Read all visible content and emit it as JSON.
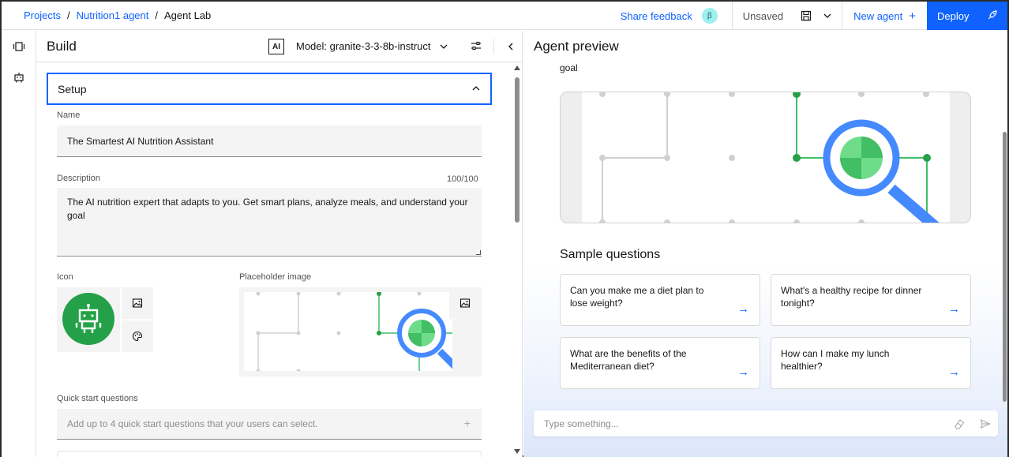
{
  "header": {
    "breadcrumb": [
      "Projects",
      "Nutrition1 agent",
      "Agent Lab"
    ],
    "separator": "/",
    "share_feedback": "Share feedback",
    "beta_badge": "β",
    "status": "Unsaved",
    "new_agent": "New agent",
    "new_agent_plus": "+",
    "deploy": "Deploy"
  },
  "build": {
    "title": "Build",
    "ai_badge": "AI",
    "model_label": "Model: granite-3-3-8b-instruct",
    "setup_title": "Setup",
    "name_label": "Name",
    "name_value": "The Smartest AI Nutrition Assistant",
    "description_label": "Description",
    "description_counter": "100/100",
    "description_value": "The AI nutrition expert that adapts to you. Get smart plans, analyze meals, and understand your goal",
    "icon_label": "Icon",
    "placeholder_image_label": "Placeholder image",
    "quick_start_label": "Quick start questions",
    "quick_start_placeholder": "Add up to 4 quick start questions that your users can select.",
    "quick_start_plus": "+"
  },
  "preview": {
    "title": "Agent preview",
    "goal_text": "goal",
    "sample_title": "Sample questions",
    "samples": [
      {
        "text": "Can you make me a diet plan to lose weight?"
      },
      {
        "text": "What's a healthy recipe for dinner tonight?"
      },
      {
        "text": "What are the benefits of the Mediterranean diet?"
      },
      {
        "text": "How can I make my lunch healthier?"
      }
    ],
    "arrow": "→",
    "chat_placeholder": "Type something..."
  },
  "colors": {
    "accent": "#0f62fe",
    "icon_green": "#24a148",
    "line_green": "#42be65",
    "magnifier_blue": "#4589ff"
  },
  "icons": [
    "project-icon",
    "agent-icon",
    "save-icon",
    "chevron-down-icon",
    "sliders-icon",
    "chevron-left-icon",
    "chevron-up-icon",
    "image-icon",
    "palette-icon",
    "robot-icon",
    "send-icon",
    "eraser-icon",
    "arrow-right-icon",
    "rocket-icon"
  ]
}
